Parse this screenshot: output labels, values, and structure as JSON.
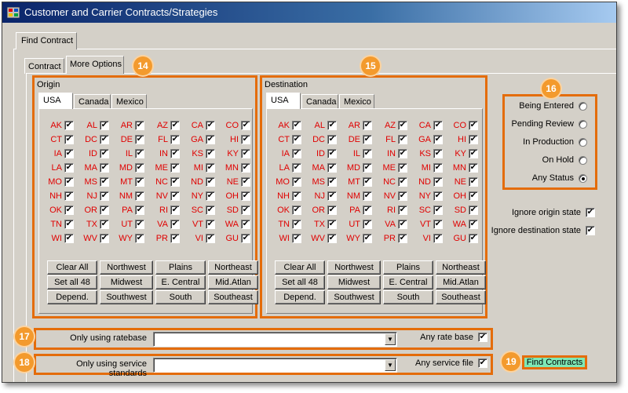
{
  "window": {
    "title": "Customer and Carrier Contracts/Strategies",
    "app_icon": "app-icon",
    "colors": {
      "highlight": "#e46c0a",
      "state_label": "#e00000",
      "find_button": "#7ee8b6"
    }
  },
  "outer_tab": {
    "label": "Find Contract"
  },
  "tabs": [
    {
      "label": "Contract"
    },
    {
      "label": "More Options"
    }
  ],
  "callouts": [
    "14",
    "15",
    "16",
    "17",
    "18",
    "19"
  ],
  "origin": {
    "title": "Origin",
    "country_tabs": [
      "USA",
      "Canada",
      "Mexico"
    ],
    "states": [
      [
        "AK",
        "AL",
        "AR",
        "AZ",
        "CA",
        "CO"
      ],
      [
        "CT",
        "DC",
        "DE",
        "FL",
        "GA",
        "HI"
      ],
      [
        "IA",
        "ID",
        "IL",
        "IN",
        "KS",
        "KY"
      ],
      [
        "LA",
        "MA",
        "MD",
        "ME",
        "MI",
        "MN"
      ],
      [
        "MO",
        "MS",
        "MT",
        "NC",
        "ND",
        "NE"
      ],
      [
        "NH",
        "NJ",
        "NM",
        "NV",
        "NY",
        "OH"
      ],
      [
        "OK",
        "OR",
        "PA",
        "RI",
        "SC",
        "SD"
      ],
      [
        "TN",
        "TX",
        "UT",
        "VA",
        "VT",
        "WA"
      ],
      [
        "WI",
        "WV",
        "WY",
        "PR",
        "VI",
        "GU"
      ]
    ],
    "buttons": [
      [
        "Clear All",
        "Northwest",
        "Plains",
        "Northeast"
      ],
      [
        "Set all 48",
        "Midwest",
        "E. Central",
        "Mid.Atlan"
      ],
      [
        "Depend.",
        "Southwest",
        "South",
        "Southeast"
      ]
    ]
  },
  "destination": {
    "title": "Destination",
    "country_tabs": [
      "USA",
      "Canada",
      "Mexico"
    ],
    "states": [
      [
        "AK",
        "AL",
        "AR",
        "AZ",
        "CA",
        "CO"
      ],
      [
        "CT",
        "DC",
        "DE",
        "FL",
        "GA",
        "HI"
      ],
      [
        "IA",
        "ID",
        "IL",
        "IN",
        "KS",
        "KY"
      ],
      [
        "LA",
        "MA",
        "MD",
        "ME",
        "MI",
        "MN"
      ],
      [
        "MO",
        "MS",
        "MT",
        "NC",
        "ND",
        "NE"
      ],
      [
        "NH",
        "NJ",
        "NM",
        "NV",
        "NY",
        "OH"
      ],
      [
        "OK",
        "OR",
        "PA",
        "RI",
        "SC",
        "SD"
      ],
      [
        "TN",
        "TX",
        "UT",
        "VA",
        "VT",
        "WA"
      ],
      [
        "WI",
        "WV",
        "WY",
        "PR",
        "VI",
        "GU"
      ]
    ],
    "buttons": [
      [
        "Clear All",
        "Northwest",
        "Plains",
        "Northeast"
      ],
      [
        "Set all 48",
        "Midwest",
        "E. Central",
        "Mid.Atlan"
      ],
      [
        "Depend.",
        "Southwest",
        "South",
        "Southeast"
      ]
    ]
  },
  "status": {
    "options": [
      "Being Entered",
      "Pending Review",
      "In Production",
      "On Hold",
      "Any Status"
    ],
    "selected": "Any Status"
  },
  "ignore": {
    "origin_label": "Ignore origin state",
    "destination_label": "Ignore destination state"
  },
  "ratebase": {
    "label": "Only using ratebase",
    "value": "",
    "any_label": "Any rate base"
  },
  "service": {
    "label": "Only using service standards",
    "value": "",
    "any_label": "Any service file"
  },
  "find_button": {
    "label": "Find Contracts"
  }
}
